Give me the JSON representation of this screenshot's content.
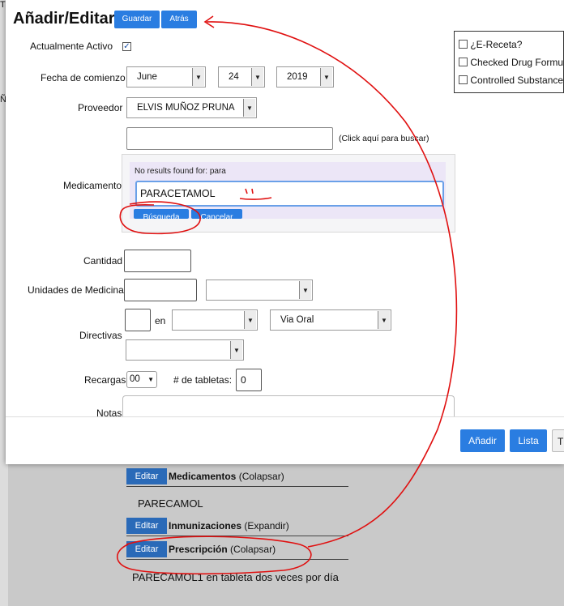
{
  "background": {
    "header_cut": "T",
    "side_cut": "Ñ",
    "sections": [
      {
        "edit": "Editar",
        "title": "Medicamentos",
        "toggle": "(Colapsar)"
      },
      {
        "edit": "Editar",
        "title": "Inmunizaciones",
        "toggle": "(Expandir)"
      },
      {
        "edit": "Editar",
        "title": "Prescripción",
        "toggle": "(Colapsar)"
      }
    ],
    "med_item": "PARECAMOL",
    "rx_item": "PARECAMOL1 en tableta dos veces por día"
  },
  "modal": {
    "title": "Añadir/Editar",
    "save": "Guardar",
    "back": "Atrás",
    "active_label": "Actualmente Activo",
    "active_check": "✓",
    "start_label": "Fecha de comienzo",
    "month": "June",
    "day": "24",
    "year": "2019",
    "provider_label": "Proveedor",
    "provider": "ELVIS MUÑOZ PRUNA",
    "search_hint": "(Click aquí para buscar)",
    "med_label": "Medicamento",
    "no_results": "No results found for: para",
    "med_value": "PARACETAMOL",
    "search_btn": "Búsqueda",
    "cancel_btn": "Cancelar",
    "qty_label": "Cantidad",
    "units_label": "Unidades de Medicina",
    "directives_label": "Directivas",
    "en": "en",
    "route": "Via Oral",
    "refills_label": "Recargas",
    "refills": "00",
    "tablets_label": "# de tabletas:",
    "tablets": "0",
    "notes_label": "Notas",
    "checks": [
      "¿E-Receta?",
      "Checked Drug Formulary?",
      "Controlled Substance?"
    ],
    "add": "Añadir",
    "list": "Lista",
    "third": "T"
  }
}
